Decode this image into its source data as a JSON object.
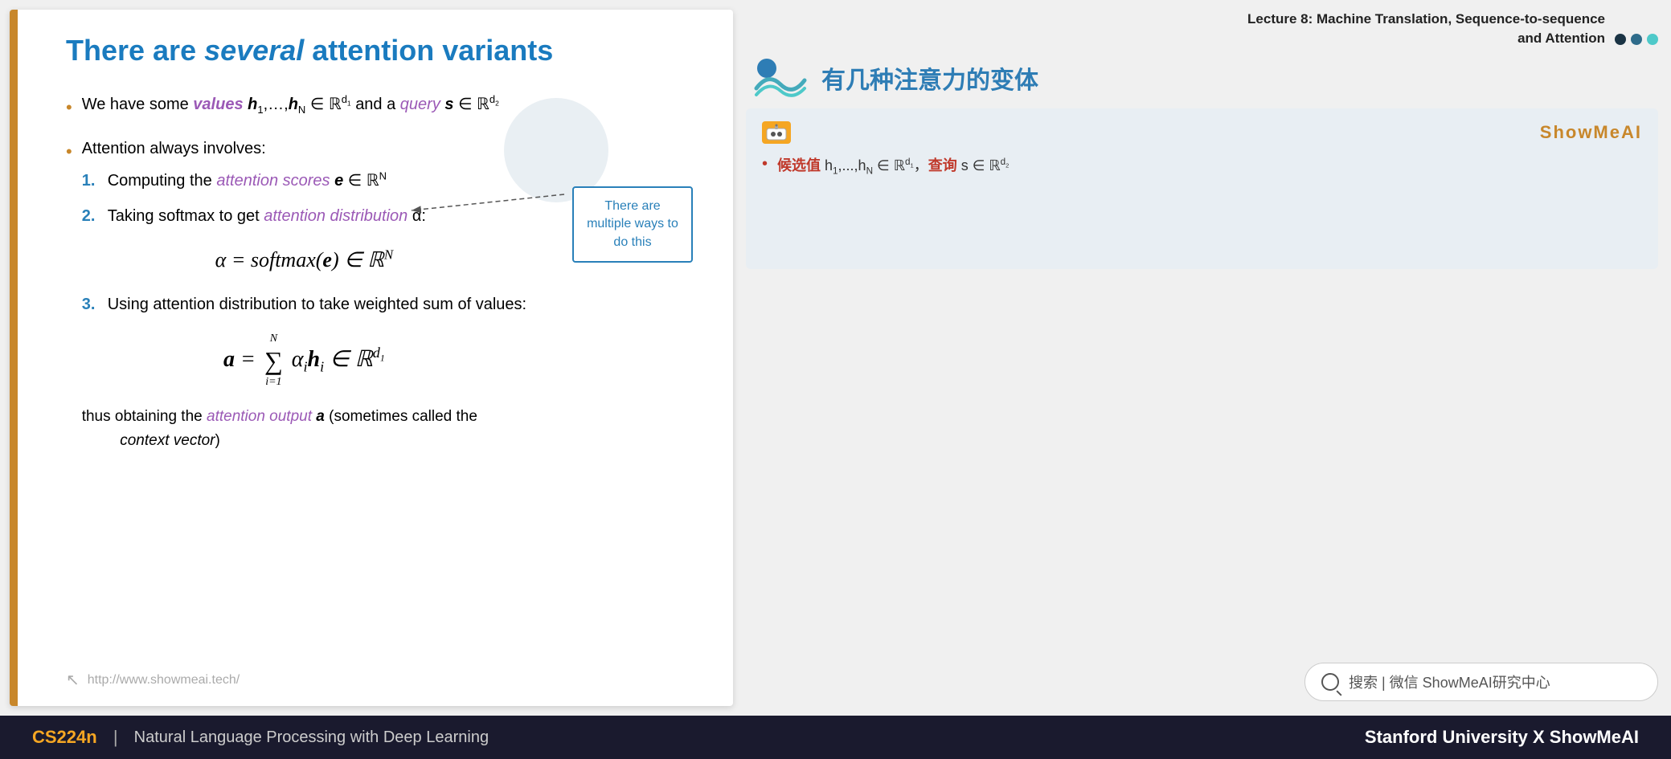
{
  "slide": {
    "title_part1": "There are ",
    "title_italic": "several",
    "title_part2": " attention variants",
    "bullet1_prefix": "We have some ",
    "bullet1_values": "values",
    "bullet1_math1": " h₁,…,h_N ∈ ℝ",
    "bullet1_d1": "d₁",
    "bullet1_mid": " and a ",
    "bullet1_query": "query",
    "bullet1_math2": " s ∈ ℝ",
    "bullet1_d2": "d₂",
    "bullet2": "Attention always involves:",
    "numbered1_prefix": "Computing the ",
    "numbered1_italic": "attention scores",
    "numbered1_math": " e ∈ ℝᴺ",
    "numbered2_prefix": "Taking softmax to get ",
    "numbered2_italic": "attention distribution",
    "numbered2_suffix": " α:",
    "formula_alpha": "α = softmax(e) ∈ ℝᴺ",
    "numbered3": "Using attention distribution to take weighted sum of values:",
    "formula_a": "a = Σ αᵢhᵢ ∈ ℝ",
    "formula_d1": "d₁",
    "conclusion_prefix": "thus obtaining the ",
    "conclusion_italic": "attention output",
    "conclusion_bold": " a",
    "conclusion_suffix": " (sometimes called the",
    "conclusion_context": "context vector",
    "conclusion_end": ")",
    "watermark_url": "http://www.showmeai.tech/",
    "annotation_text": "There are multiple ways to do this"
  },
  "right": {
    "lecture_title": "Lecture 8:  Machine Translation, Sequence-to-sequence",
    "lecture_subtitle": "and Attention",
    "chinese_title": "有几种注意力的变体",
    "card_brand": "ShowMeAI",
    "card_bullet_red1": "候选值",
    "card_bullet_math1": " h₁,...,hₙ ∈ ℝ",
    "card_bullet_d1": "d₁",
    "card_bullet_comma": "，",
    "card_bullet_red2": "查询",
    "card_bullet_math2": " s ∈ ℝ",
    "card_bullet_d2": "d₂",
    "search_placeholder": "搜索 | 微信 ShowMeAI研究中心"
  },
  "footer": {
    "course_code": "CS224n",
    "divider": "|",
    "course_name": "Natural Language Processing with Deep Learning",
    "university": "Stanford University",
    "x": "X",
    "brand": "ShowMeAI"
  }
}
